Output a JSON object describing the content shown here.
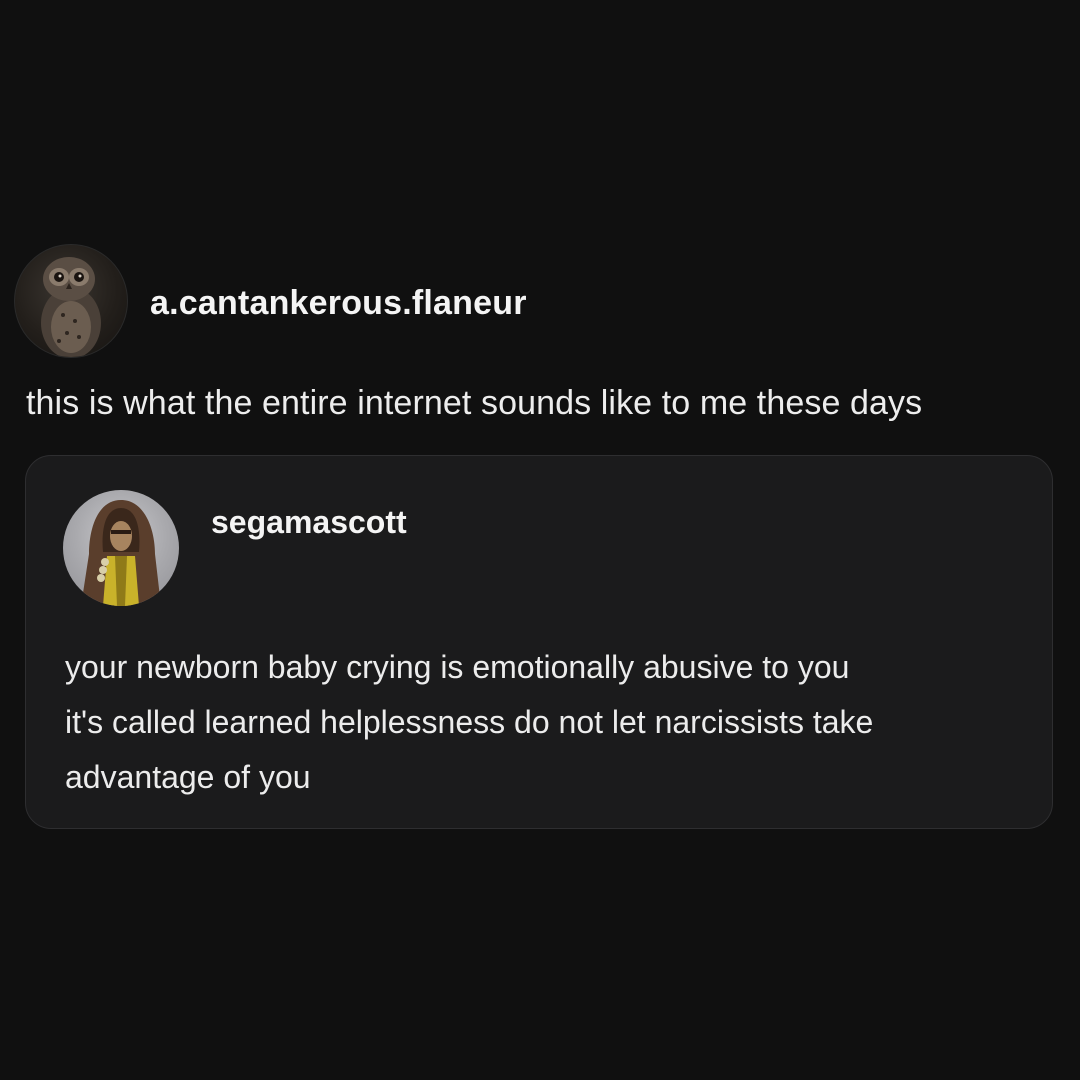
{
  "post": {
    "author": {
      "username": "a.cantankerous.flaneur",
      "avatar_icon": "owl-avatar-icon"
    },
    "caption": "this is what the entire internet sounds like to me these days",
    "reblog": {
      "author": {
        "username": "segamascott",
        "avatar_icon": "hooded-figure-avatar-icon"
      },
      "lines": [
        "your newborn baby crying is emotionally abusive to you",
        "it's called learned helplessness do not let narcissists take",
        "advantage of you"
      ]
    }
  },
  "colors": {
    "background": "#101010",
    "card_background": "#1b1b1c",
    "card_border": "#2e2e30",
    "text": "#f1f1f1"
  }
}
